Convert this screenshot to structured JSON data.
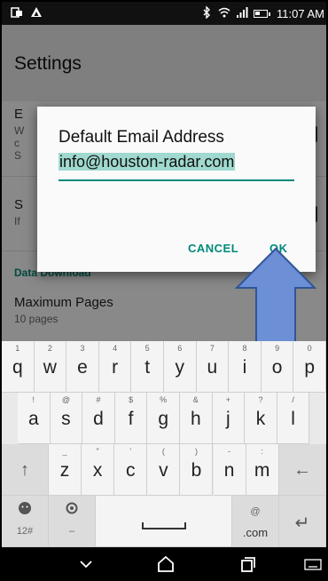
{
  "status": {
    "time": "11:07 AM"
  },
  "appbar": {
    "title": "Settings"
  },
  "settings": {
    "item1": {
      "title": "E",
      "sub": "W",
      "sub2": "c",
      "sub3": "S"
    },
    "item2": {
      "title": "S",
      "sub": "If"
    },
    "section_header": "Data Download",
    "item3": {
      "title": "Maximum Pages",
      "sub": "10 pages"
    }
  },
  "dialog": {
    "title": "Default Email Address",
    "email_value": "info@houston-radar.com",
    "cancel_label": "CANCEL",
    "ok_label": "OK"
  },
  "keyboard": {
    "row1": [
      {
        "k": "q",
        "h": "1"
      },
      {
        "k": "w",
        "h": "2"
      },
      {
        "k": "e",
        "h": "3"
      },
      {
        "k": "r",
        "h": "4"
      },
      {
        "k": "t",
        "h": "5"
      },
      {
        "k": "y",
        "h": "6"
      },
      {
        "k": "u",
        "h": "7"
      },
      {
        "k": "i",
        "h": "8"
      },
      {
        "k": "o",
        "h": "9"
      },
      {
        "k": "p",
        "h": "0"
      }
    ],
    "row2": [
      {
        "k": "a",
        "h": "!"
      },
      {
        "k": "s",
        "h": "@"
      },
      {
        "k": "d",
        "h": "#"
      },
      {
        "k": "f",
        "h": "$"
      },
      {
        "k": "g",
        "h": "%"
      },
      {
        "k": "h",
        "h": "&"
      },
      {
        "k": "j",
        "h": "+"
      },
      {
        "k": "k",
        "h": "?"
      },
      {
        "k": "l",
        "h": "/"
      }
    ],
    "row3": [
      {
        "k": "z",
        "h": "_"
      },
      {
        "k": "x",
        "h": "\""
      },
      {
        "k": "c",
        "h": "'"
      },
      {
        "k": "v",
        "h": "("
      },
      {
        "k": "b",
        "h": ")"
      },
      {
        "k": "n",
        "h": "-"
      },
      {
        "k": "m",
        "h": ":"
      }
    ],
    "shift": "↑",
    "backspace": "←",
    "sym_label": "12#",
    "dash_hint": "–",
    "com_label": ".com",
    "at_hint": "@",
    "dot_label": "·",
    "enter": "↵"
  },
  "colors": {
    "accent": "#00897b",
    "arrow_fill": "#6d8fd6",
    "arrow_stroke": "#2f5597"
  }
}
